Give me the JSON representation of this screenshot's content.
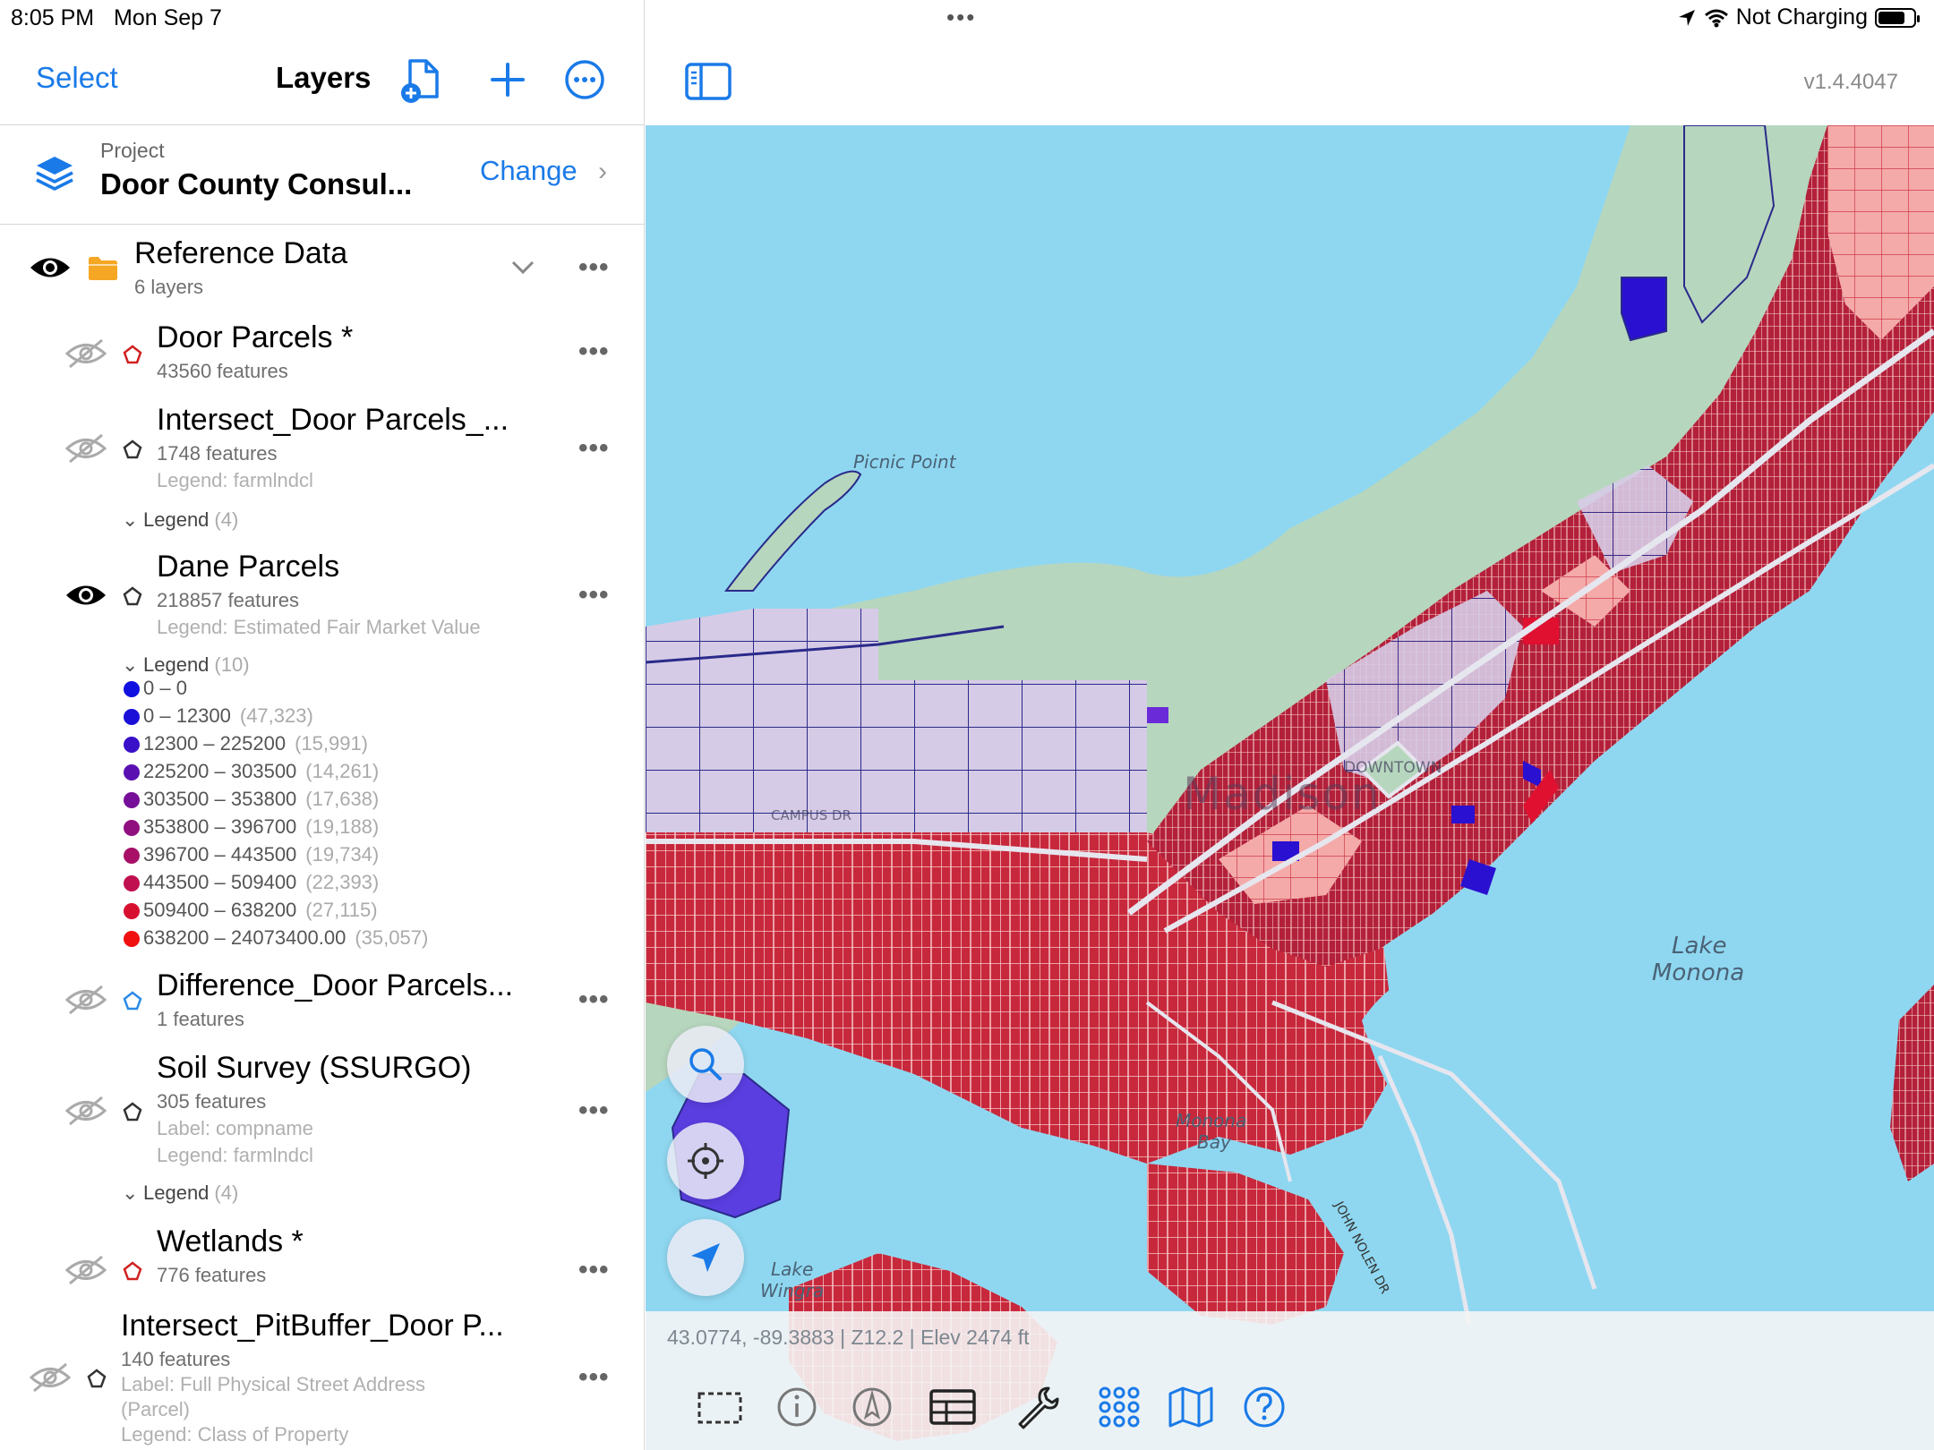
{
  "status": {
    "time": "8:05 PM",
    "date": "Mon Sep 7",
    "charging": "Not Charging"
  },
  "sidebar": {
    "select_label": "Select",
    "title": "Layers",
    "project_label": "Project",
    "project_name": "Door County Consul...",
    "change_label": "Change"
  },
  "group": {
    "name": "Reference Data",
    "count": "6 layers"
  },
  "layers": [
    {
      "name": "Door Parcels *",
      "features": "43560 features"
    },
    {
      "name": "Intersect_Door Parcels_...",
      "features": "1748 features",
      "legend_label": "Legend: farmlndcl",
      "legend_header": "Legend",
      "legend_count": "(4)"
    },
    {
      "name": "Dane Parcels",
      "features": "218857 features",
      "legend_label": "Legend: Estimated Fair Market Value",
      "legend_header": "Legend",
      "legend_count": "(10)"
    },
    {
      "name": "Difference_Door Parcels...",
      "features": "1 features"
    },
    {
      "name": "Soil Survey (SSURGO)",
      "features": "305 features",
      "label_label": "Label: compname",
      "legend_label": "Legend: farmlndcl",
      "legend_header": "Legend",
      "legend_count": "(4)"
    },
    {
      "name": "Wetlands *",
      "features": "776 features"
    },
    {
      "name": "Intersect_PitBuffer_Door P...",
      "features": "140 features",
      "label_label": "Label: Full Physical Street Address",
      "label_label2": "(Parcel)",
      "legend_label": "Legend: Class of Property"
    }
  ],
  "legend_items": [
    {
      "range": "0 – 0",
      "count": "",
      "color": "#1010e0"
    },
    {
      "range": "0 – 12300",
      "count": "(47,323)",
      "color": "#1a10d8"
    },
    {
      "range": "12300 – 225200",
      "count": "(15,991)",
      "color": "#3a10c8"
    },
    {
      "range": "225200 – 303500",
      "count": "(14,261)",
      "color": "#5a10b0"
    },
    {
      "range": "303500 – 353800",
      "count": "(17,638)",
      "color": "#761098"
    },
    {
      "range": "353800 – 396700",
      "count": "(19,188)",
      "color": "#901080"
    },
    {
      "range": "396700 – 443500",
      "count": "(19,734)",
      "color": "#a81068"
    },
    {
      "range": "443500 – 509400",
      "count": "(22,393)",
      "color": "#c01050"
    },
    {
      "range": "509400 – 638200",
      "count": "(27,115)",
      "color": "#d81030"
    },
    {
      "range": "638200 – 24073400.00",
      "count": "(35,057)",
      "color": "#f01010"
    }
  ],
  "map": {
    "version": "v1.4.4047",
    "coords": "43.0774, -89.3883 | Z12.2 | Elev 2474 ft",
    "labels": {
      "picnic_point": "Picnic Point",
      "madison": "Madison",
      "lake_monona_1": "Lake",
      "lake_monona_2": "Monona",
      "monona_bay_1": "Monona",
      "monona_bay_2": "Bay",
      "lake_wingra_1": "Lake",
      "lake_wingra_2": "Wingra",
      "downtown": "DOWNTOWN",
      "campus_dr": "CAMPUS DR",
      "john_nolen": "JOHN NOLEN DR"
    }
  },
  "colors": {
    "accent": "#1a7ae8",
    "water": "#8fd7f0",
    "parcel_red": "#c8283c",
    "parcel_pink": "#f4a8a8",
    "parcel_lavender": "#d0c4e4",
    "parcel_line": "#2a2a8a"
  }
}
